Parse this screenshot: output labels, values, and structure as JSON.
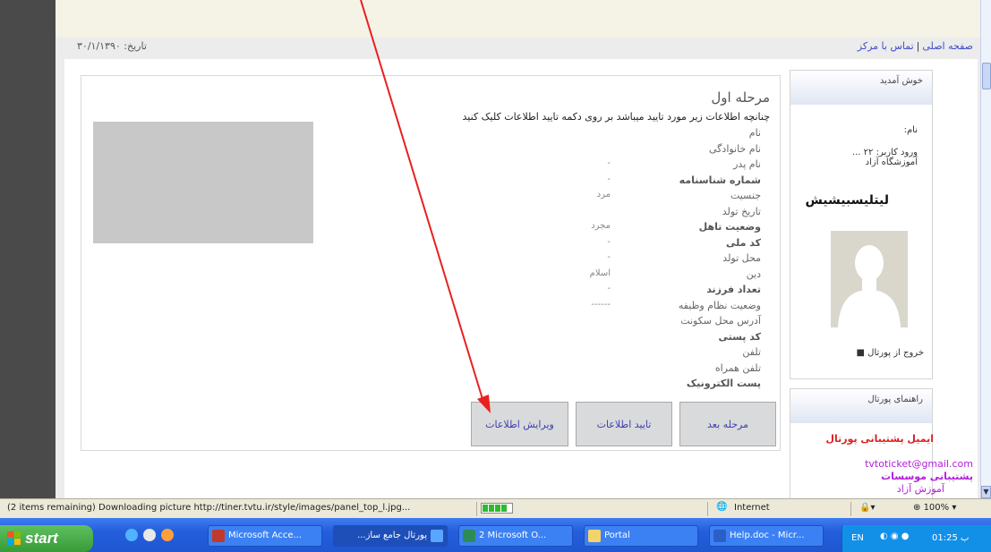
{
  "header": {
    "links": [
      "صفحه اصلی",
      "تماس با مرکز"
    ],
    "link_separator": "|",
    "date_label": "تاریخ:",
    "date_value": "۳۰/۱/۱۳۹۰"
  },
  "main": {
    "step_title": "مرحله اول",
    "instruction": "چنانچه اطلاعات زیر مورد تایید میباشد بر روی دکمه تایید اطلاعات کلیک کنید",
    "fields": [
      {
        "label": "نام",
        "value": "",
        "bold": false
      },
      {
        "label": "نام خانوادگی",
        "value": "",
        "bold": false
      },
      {
        "label": "نام پدر",
        "value": "-",
        "bold": false
      },
      {
        "label": "شماره شناسنامه",
        "value": "-",
        "bold": true
      },
      {
        "label": "جنسیت",
        "value": "مرد",
        "bold": false
      },
      {
        "label": "تاریخ تولد",
        "value": "",
        "bold": false
      },
      {
        "label": "وضعیت تاهل",
        "value": "مجرد",
        "bold": true
      },
      {
        "label": "کد ملی",
        "value": "-",
        "bold": true
      },
      {
        "label": "محل تولد",
        "value": "-",
        "bold": false
      },
      {
        "label": "دین",
        "value": "اسلام",
        "bold": false
      },
      {
        "label": "تعداد فرزند",
        "value": "-",
        "bold": true
      },
      {
        "label": "وضعیت نظام وظیفه",
        "value": "------",
        "bold": false
      },
      {
        "label": "آدرس محل سکونت",
        "value": "",
        "bold": false
      },
      {
        "label": "کد پستی",
        "value": "",
        "bold": true
      },
      {
        "label": "تلفن",
        "value": "",
        "bold": false
      },
      {
        "label": "تلفن همراه",
        "value": "",
        "bold": false
      },
      {
        "label": "پست الکترونیک",
        "value": "",
        "bold": true
      }
    ],
    "buttons": {
      "next_step": "مرحله بعد",
      "confirm": "تایید اطلاعات",
      "edit": "ویرایش اطلاعات"
    }
  },
  "sidebar": {
    "welcome_title": "خوش آمدید",
    "name_label": "نام:",
    "entry_date": "ورود کاربر: ۲۲ ...",
    "institute": "آموزشگاه آزاد",
    "username": "لیتلیسبیشیش",
    "logout": "خروج از پورتال",
    "guides_title": "راهنمای پورتال",
    "support_email_title": "ایمیل پشتیبانی پورتال",
    "support_email": "tvtoticket@gmail.com",
    "institutes_support": "پشتیبانی موسسات",
    "free_institute": "آموزش آزاد"
  },
  "statusbar": {
    "message": "(2 items remaining) Downloading picture http://tiner.tvtu.ir/style/images/panel_top_l.jpg...",
    "zone": "Internet",
    "zoom": "100%"
  },
  "taskbar": {
    "start_label": "start",
    "items": [
      "Microsoft Acce...",
      "پورتال جامع ساز...",
      "2 Microsoft O...",
      "Portal",
      "Help.doc - Micr..."
    ],
    "lang": "EN",
    "clock": "01:25 ب"
  },
  "colors": {
    "link": "#3f4dc8",
    "button_text": "#3a3fb0",
    "support_red": "#e01f1f",
    "support_purple": "#b21fd8",
    "taskbar_blue": "#245edb",
    "start_green": "#379b37"
  }
}
